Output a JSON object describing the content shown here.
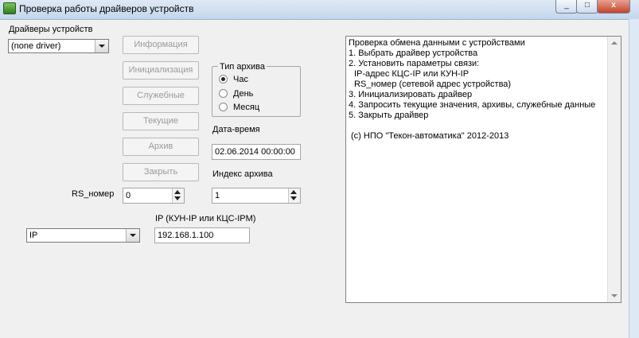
{
  "window": {
    "title": "Проверка работы драйверов устройств",
    "minimize_glyph": "_",
    "maximize_glyph": "□",
    "close_glyph": "x"
  },
  "driver": {
    "label": "Драйверы устройств",
    "selected": "(none driver)"
  },
  "buttons": {
    "info": "Информация",
    "init": "Инициализация",
    "service": "Служебные",
    "current": "Текущие",
    "archive": "Архив",
    "close": "Закрыть"
  },
  "archive_type": {
    "title": "Тип архива",
    "options": [
      {
        "label": "Час",
        "checked": true
      },
      {
        "label": "День",
        "checked": false
      },
      {
        "label": "Месяц",
        "checked": false
      }
    ]
  },
  "datetime": {
    "label": "Дата-время",
    "value": "02.06.2014 00:00:00"
  },
  "archive_index": {
    "label": "Индекс архива",
    "value": "1"
  },
  "rs_number": {
    "label": "RS_номер",
    "value": "0"
  },
  "connection": {
    "selected": "IP",
    "ip_label": "IP (КУН-IP или КЦС-IPM)",
    "ip_value": "192.168.1.100"
  },
  "info_text": {
    "lines": [
      "Проверка обмена данными с устройствами",
      "1. Выбрать драйвер устройства",
      "2. Установить параметры связи:",
      "   IP-адрес КЦС-IP или КУН-IP",
      "   RS_номер (сетевой адрес устройства)",
      "3. Инициализировать драйвер",
      "4. Запросить текущие значения, архивы, служебные данные",
      "5. Закрыть драйвер",
      "",
      " (c)  НПО \"Текон-автоматика\"  2012-2013"
    ]
  },
  "icons": {
    "app": "app-icon",
    "dropdown": "chevron-down-icon",
    "spin_up": "spin-up-icon",
    "spin_down": "spin-down-icon"
  }
}
